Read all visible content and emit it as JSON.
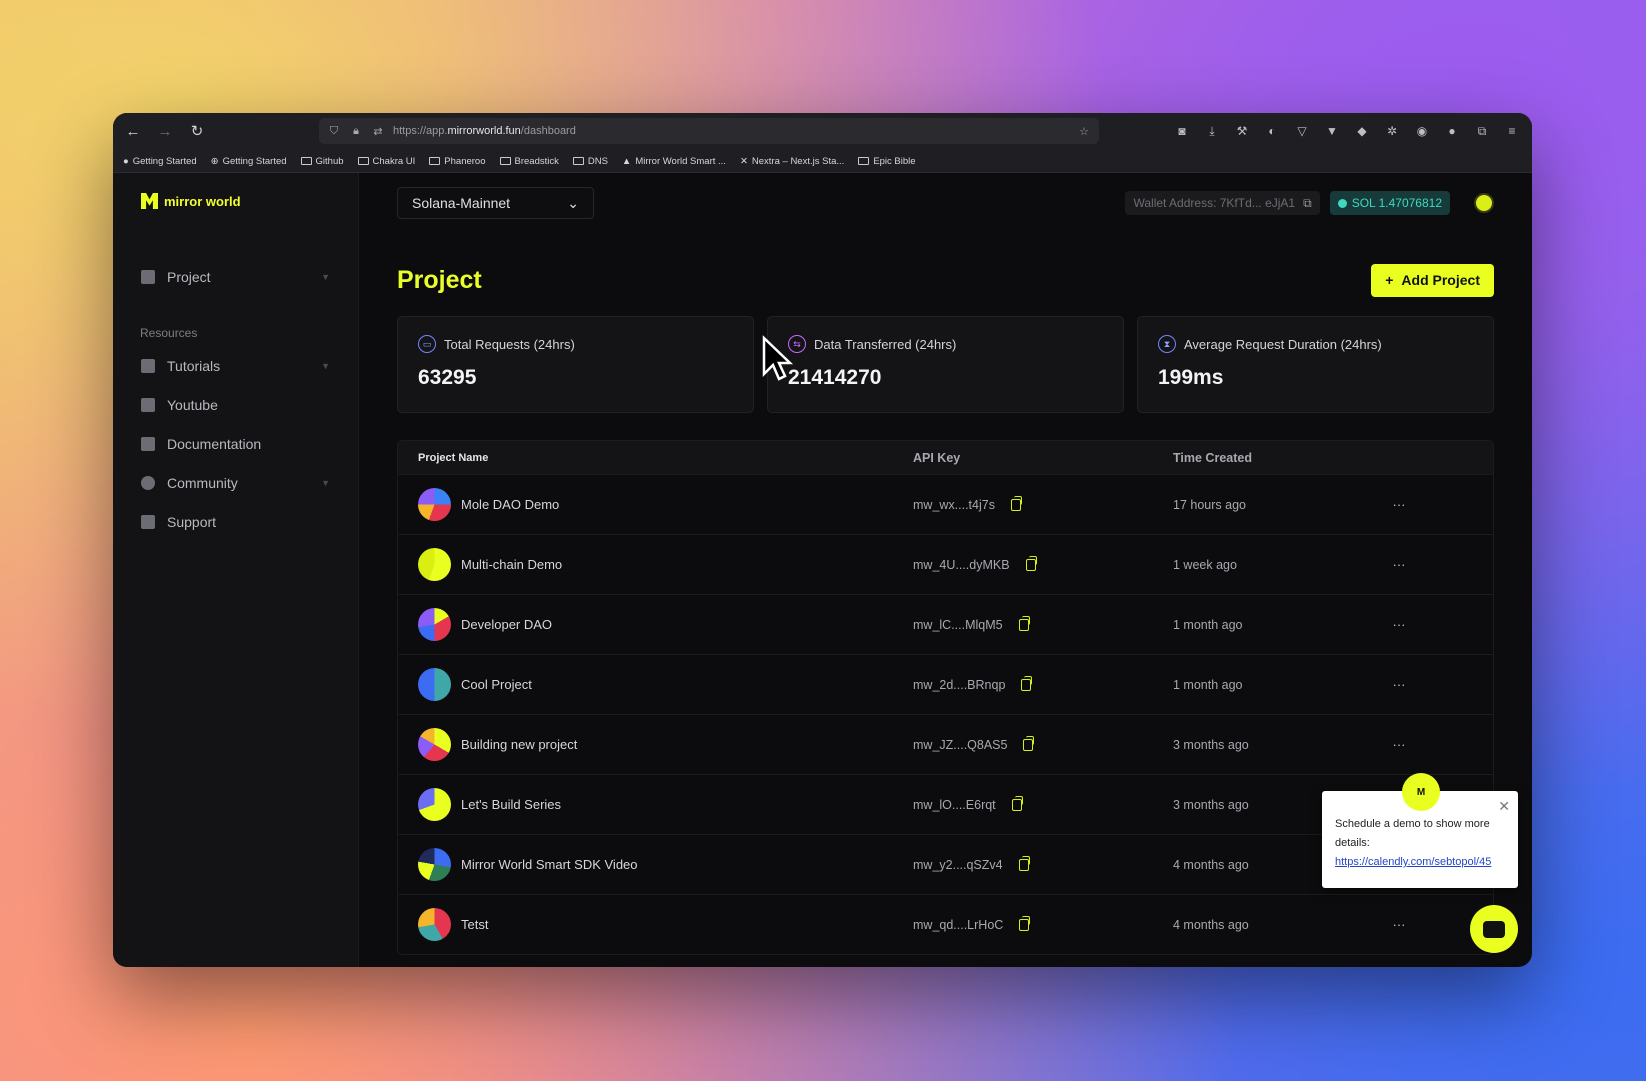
{
  "browser": {
    "url_prefix": "https://app.",
    "url_domain": "mirrorworld.fun",
    "url_path": "/dashboard",
    "bookmarks": [
      "Getting Started",
      "Getting Started",
      "Github",
      "Chakra UI",
      "Phaneroo",
      "Breadstick",
      "DNS",
      "Mirror World Smart ...",
      "Nextra – Next.js Sta...",
      "Epic Bible"
    ]
  },
  "sidebar": {
    "logo": "mirror world",
    "project": "Project",
    "resources_heading": "Resources",
    "items": [
      "Tutorials",
      "Youtube",
      "Documentation",
      "Community",
      "Support"
    ]
  },
  "topbar": {
    "network": "Solana-Mainnet",
    "wallet": "Wallet Address: 7KfTd... eJjA1",
    "sol": "SOL 1.47076812"
  },
  "page": {
    "title": "Project",
    "add_button": "Add Project"
  },
  "stats": [
    {
      "label": "Total Requests (24hrs)",
      "value": "63295"
    },
    {
      "label": "Data Transferred (24hrs)",
      "value": "21414270"
    },
    {
      "label": "Average Request Duration (24hrs)",
      "value": "199ms"
    }
  ],
  "table": {
    "headers": [
      "Project Name",
      "API Key",
      "Time Created"
    ],
    "rows": [
      {
        "name": "Mole DAO Demo",
        "key": "mw_wx....t4j7s",
        "time": "17 hours ago"
      },
      {
        "name": "Multi-chain Demo",
        "key": "mw_4U....dyMKB",
        "time": "1 week ago"
      },
      {
        "name": "Developer DAO",
        "key": "mw_lC....MlqM5",
        "time": "1 month ago"
      },
      {
        "name": "Cool Project",
        "key": "mw_2d....BRnqp",
        "time": "1 month ago"
      },
      {
        "name": "Building new project",
        "key": "mw_JZ....Q8AS5",
        "time": "3 months ago"
      },
      {
        "name": "Let's Build Series",
        "key": "mw_lO....E6rqt",
        "time": "3 months ago"
      },
      {
        "name": "Mirror World Smart SDK Video",
        "key": "mw_y2....qSZv4",
        "time": "4 months ago"
      },
      {
        "name": "Tetst",
        "key": "mw_qd....LrHoC",
        "time": "4 months ago"
      }
    ]
  },
  "popup": {
    "text": "Schedule a demo to show more details: ",
    "link": "https://calendly.com/sebtopol/45"
  },
  "colors": {
    "accent": "#e9ff1f",
    "background": "#0c0c0e",
    "sol": "#3fd9c1"
  }
}
